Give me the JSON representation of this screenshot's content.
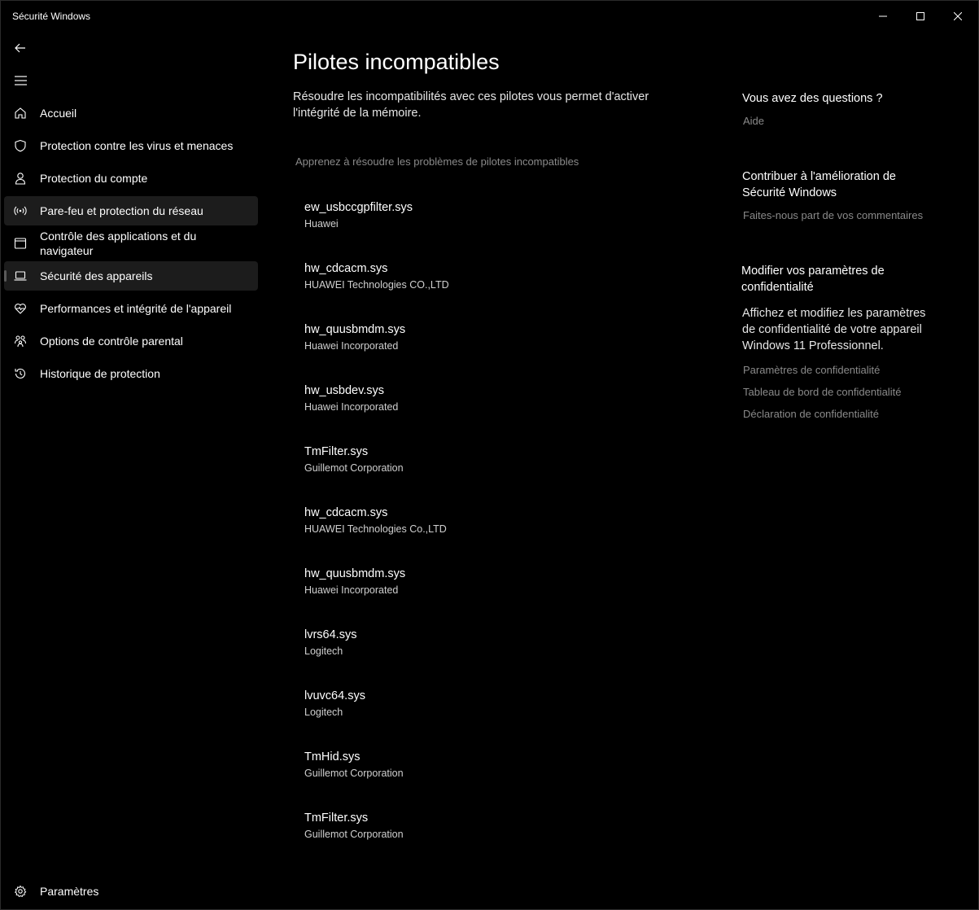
{
  "window": {
    "title": "Sécurité Windows",
    "controls": [
      "minimize-icon",
      "maximize-icon",
      "close-icon"
    ]
  },
  "sidebar": {
    "back_icon": "back-arrow-icon",
    "menu_icon": "hamburger-icon",
    "items": [
      {
        "label": "Accueil",
        "icon": "home-icon"
      },
      {
        "label": "Protection contre les virus et menaces",
        "icon": "shield-icon"
      },
      {
        "label": "Protection du compte",
        "icon": "person-icon"
      },
      {
        "label": "Pare-feu et protection du réseau",
        "icon": "antenna-icon"
      },
      {
        "label": "Contrôle des applications et du navigateur",
        "icon": "browser-window-icon"
      },
      {
        "label": "Sécurité des appareils",
        "icon": "laptop-icon"
      },
      {
        "label": "Performances et intégrité de l'appareil",
        "icon": "heart-pulse-icon"
      },
      {
        "label": "Options de contrôle parental",
        "icon": "family-icon"
      },
      {
        "label": "Historique de protection",
        "icon": "history-icon"
      }
    ],
    "settings": {
      "label": "Paramètres",
      "icon": "gear-icon"
    }
  },
  "main": {
    "title": "Pilotes incompatibles",
    "description": "Résoudre les incompatibilités avec ces pilotes vous permet d'activer l'intégrité de la mémoire.",
    "learn_link": "Apprenez à résoudre les problèmes de pilotes incompatibles",
    "drivers": [
      {
        "name": "ew_usbccgpfilter.sys",
        "vendor": "Huawei"
      },
      {
        "name": "hw_cdcacm.sys",
        "vendor": "HUAWEI Technologies CO.,LTD"
      },
      {
        "name": "hw_quusbmdm.sys",
        "vendor": "Huawei Incorporated"
      },
      {
        "name": "hw_usbdev.sys",
        "vendor": "Huawei Incorporated"
      },
      {
        "name": "TmFilter.sys",
        "vendor": "Guillemot Corporation"
      },
      {
        "name": "hw_cdcacm.sys",
        "vendor": "HUAWEI Technologies Co.,LTD"
      },
      {
        "name": "hw_quusbmdm.sys",
        "vendor": "Huawei Incorporated"
      },
      {
        "name": "lvrs64.sys",
        "vendor": "Logitech"
      },
      {
        "name": "lvuvc64.sys",
        "vendor": "Logitech"
      },
      {
        "name": "TmHid.sys",
        "vendor": "Guillemot Corporation"
      },
      {
        "name": "TmFilter.sys",
        "vendor": "Guillemot Corporation"
      }
    ]
  },
  "side": {
    "questions": {
      "heading": "Vous avez des questions ?",
      "link": "Aide"
    },
    "improve": {
      "heading": "Contribuer à l'amélioration de Sécurité Windows",
      "link": "Faites-nous part de vos commentaires"
    },
    "privacy": {
      "heading": "Modifier vos paramètres de confidentialité",
      "text": "Affichez et modifiez les paramètres de confidentialité de votre appareil Windows 11 Professionnel.",
      "links": [
        "Paramètres de confidentialité",
        "Tableau de bord de confidentialité",
        "Déclaration de confidentialité"
      ]
    }
  }
}
